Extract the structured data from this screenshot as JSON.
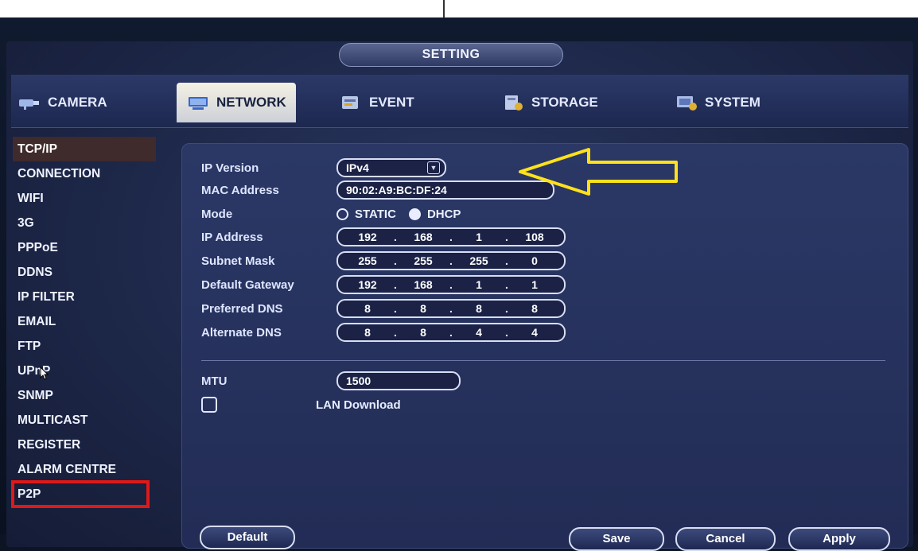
{
  "window": {
    "title": "SETTING"
  },
  "tabs": [
    {
      "label": "CAMERA",
      "icon": "camera-icon"
    },
    {
      "label": "NETWORK",
      "icon": "network-icon",
      "active": true
    },
    {
      "label": "EVENT",
      "icon": "event-icon"
    },
    {
      "label": "STORAGE",
      "icon": "storage-icon"
    },
    {
      "label": "SYSTEM",
      "icon": "system-icon"
    }
  ],
  "sidebar": {
    "items": [
      {
        "label": "TCP/IP",
        "active": true
      },
      {
        "label": "CONNECTION"
      },
      {
        "label": "WIFI"
      },
      {
        "label": "3G"
      },
      {
        "label": "PPPoE"
      },
      {
        "label": "DDNS"
      },
      {
        "label": "IP FILTER"
      },
      {
        "label": "EMAIL"
      },
      {
        "label": "FTP"
      },
      {
        "label": "UPnP"
      },
      {
        "label": "SNMP"
      },
      {
        "label": "MULTICAST"
      },
      {
        "label": "REGISTER"
      },
      {
        "label": "ALARM CENTRE"
      },
      {
        "label": "P2P",
        "highlighted": true
      }
    ]
  },
  "form": {
    "ip_version": {
      "label": "IP Version",
      "value": "IPv4"
    },
    "mac_address": {
      "label": "MAC Address",
      "value": "90:02:A9:BC:DF:24"
    },
    "mode": {
      "label": "Mode",
      "options": [
        "STATIC",
        "DHCP"
      ],
      "selected": "DHCP"
    },
    "ip_address": {
      "label": "IP Address",
      "octets": [
        "192",
        "168",
        "1",
        "108"
      ]
    },
    "subnet_mask": {
      "label": "Subnet Mask",
      "octets": [
        "255",
        "255",
        "255",
        "0"
      ]
    },
    "default_gateway": {
      "label": "Default Gateway",
      "octets": [
        "192",
        "168",
        "1",
        "1"
      ]
    },
    "preferred_dns": {
      "label": "Preferred DNS",
      "octets": [
        "8",
        "8",
        "8",
        "8"
      ]
    },
    "alternate_dns": {
      "label": "Alternate DNS",
      "octets": [
        "8",
        "8",
        "4",
        "4"
      ]
    },
    "mtu": {
      "label": "MTU",
      "value": "1500"
    },
    "lan_download": {
      "label": "LAN Download",
      "checked": false
    }
  },
  "buttons": {
    "default": "Default",
    "save": "Save",
    "cancel": "Cancel",
    "apply": "Apply"
  },
  "colors": {
    "highlight_box": "#e01818",
    "annotation_arrow": "#ffe11a",
    "active_tab": "#f4f1e4"
  }
}
